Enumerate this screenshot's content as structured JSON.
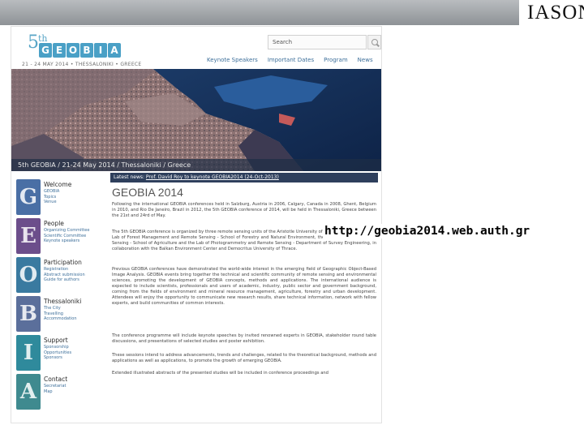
{
  "slide": {
    "logo_text": "IASON",
    "url_text": "http://geobia2014.web.auth.gr"
  },
  "site": {
    "logo": {
      "number": "5",
      "ordinal": "th",
      "letters": [
        "G",
        "E",
        "O",
        "B",
        "I",
        "A"
      ],
      "subtitle": "21 - 24 MAY 2014 • THESSALONIKI • GREECE"
    },
    "search_placeholder": "Search",
    "nav": [
      "Keynote Speakers",
      "Important Dates",
      "Program",
      "News"
    ],
    "banner_caption": "5th GEOBIA / 21-24 May 2014 / Thessaloniki / Greece",
    "sidebar": [
      {
        "heading": "Welcome",
        "letter": "G",
        "color": "#4a6fa5",
        "links": [
          "GEOBIA",
          "Topics",
          "Venue"
        ]
      },
      {
        "heading": "People",
        "letter": "E",
        "color": "#6c4e8b",
        "links": [
          "Organizing Committee",
          "Scientific Committee",
          "Keynote speakers"
        ]
      },
      {
        "heading": "Participation",
        "letter": "O",
        "color": "#3a7aa0",
        "links": [
          "Registration",
          "Abstract submission",
          "Guide for authors"
        ]
      },
      {
        "heading": "Thessaloniki",
        "letter": "B",
        "color": "#5b6f9b",
        "links": [
          "The City",
          "Travelling",
          "Accommodation"
        ]
      },
      {
        "heading": "Support",
        "letter": "I",
        "color": "#2f8a9c",
        "links": [
          "Sponsorship",
          "Opportunities",
          "Sponsors"
        ]
      },
      {
        "heading": "Contact",
        "letter": "A",
        "color": "#3f8a8f",
        "links": [
          "Secretariat",
          "Map"
        ]
      }
    ],
    "news_label": "Latest news:",
    "news_text": "Prof. David Roy to keynote GEOBIA2014 (24-Oct-2013)",
    "title": "GEOBIA 2014",
    "paragraphs": [
      "Following the international GEOBIA conferences held in Salzburg, Austria in 2006, Calgary, Canada in 2008, Ghent, Belgium in 2010, and Rio De Janeiro, Brazil in 2012, the 5th GEOBIA conference of 2014, will be held in Thessaloniki, Greece between the 21st and 24rd of May.",
      "The 5th GEOBIA conference is organized by three remote sensing units of the Aristotle University of Thessaloniki, namely the Lab of Forest Management and Remote Sensing - School of Forestry and Natural Environment, the Lab of GIS and Remote Sensing - School of Agriculture and the Lab of Photogrammetry and Remote Sensing - Department of Survey Engineering, in collaboration with the Balkan Environment Center and Democritus University of Thrace.",
      "Previous GEOBIA conferences have demonstrated the world-wide interest in the emerging field of Geographic Object-Based Image Analysis. GEOBIA events bring together the technical and scientific community of remote sensing and environmental sciences, promoting the development of GEOBIA concepts, methods and applications. The international audience is expected to include scientists, professionals and users of academic, industry, public sector and government background, coming from the fields of environment and mineral resource management, agriculture, forestry and urban development. Attendees will enjoy the opportunity to communicate new research results, share technical information, network with fellow experts, and build communities of common interests.",
      "The conference programme will include keynote speeches by invited renowned experts in GEOBIA, stakeholder round table discussions, and presentations of selected studies and poster exhibition.",
      "These sessions intend to address advancements, trends and challenges, related to the theoretical background, methods and applications as well as applications, to promote the growth of emerging GEOBIA.",
      "Extended illustrated abstracts of the presented studies will be included in conference proceedings and"
    ]
  }
}
